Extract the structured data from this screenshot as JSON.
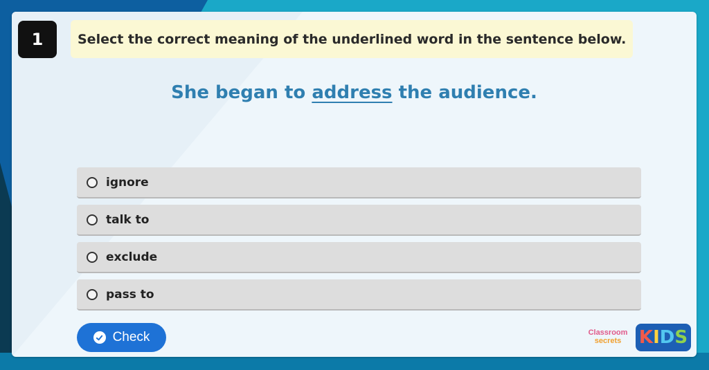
{
  "question": {
    "number": "1",
    "instruction": "Select the correct meaning of the underlined word in the sentence below.",
    "sentence": {
      "before": "She began to",
      "target": "address",
      "after": "the audience."
    }
  },
  "options": [
    {
      "label": "ignore"
    },
    {
      "label": "talk to"
    },
    {
      "label": "exclude"
    },
    {
      "label": "pass to"
    }
  ],
  "check_button": {
    "label": "Check"
  },
  "branding": {
    "classroom_secrets_line1": "Classroom",
    "classroom_secrets_line2": "secrets",
    "kids_letters": [
      "K",
      "I",
      "D",
      "S"
    ]
  },
  "colors": {
    "sentence": "#2f7fb0",
    "check_button": "#1e72d6",
    "instruction_bg": "#fbf8d4"
  }
}
